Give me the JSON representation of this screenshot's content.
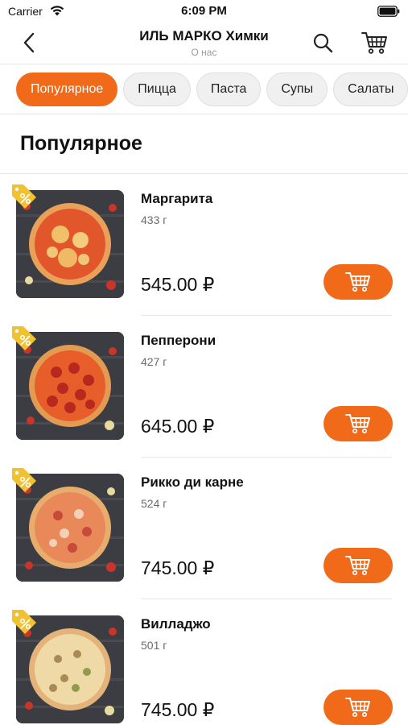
{
  "status_bar": {
    "carrier": "Carrier",
    "time": "6:09 PM"
  },
  "nav": {
    "title": "ИЛЬ МАРКО Химки",
    "subtitle": "О нас"
  },
  "categories": [
    "Популярное",
    "Пицца",
    "Паста",
    "Супы",
    "Салаты"
  ],
  "active_category": "Популярное",
  "section_title": "Популярное",
  "products": [
    {
      "name": "Маргарита",
      "weight": "433 г",
      "price": "545.00 ₽"
    },
    {
      "name": "Пепперони",
      "weight": "427 г",
      "price": "645.00 ₽"
    },
    {
      "name": "Рикко ди карне",
      "weight": "524 г",
      "price": "745.00 ₽"
    },
    {
      "name": "Вилладжо",
      "weight": "501 г",
      "price": "745.00 ₽"
    }
  ],
  "colors": {
    "accent": "#f06a1a",
    "promo": "#f2c12e",
    "text": "#111111",
    "muted": "#6b6b6b"
  },
  "icons": [
    "wifi-icon",
    "battery-icon",
    "back-arrow-icon",
    "search-icon",
    "cart-icon",
    "promo-tag-icon",
    "add-to-cart-icon"
  ]
}
